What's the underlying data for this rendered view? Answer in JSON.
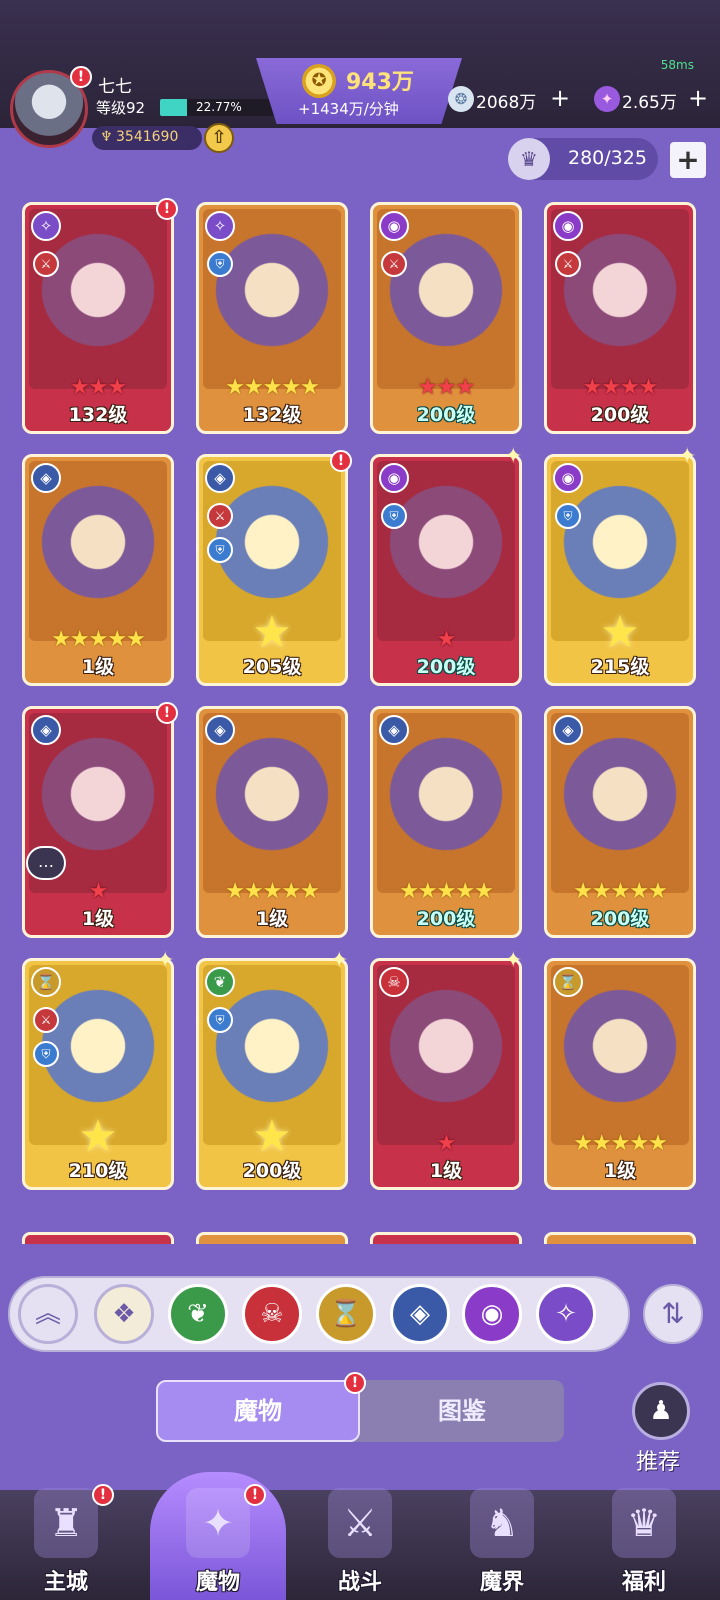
{
  "status": {
    "ping": "58ms"
  },
  "player": {
    "name": "七七",
    "level_label": "等级92",
    "xp_percent_text": "22.77%",
    "xp_fraction": 0.2277,
    "power": "3541690"
  },
  "currencies": {
    "gold_amount": "943万",
    "gold_rate": "+1434万/分钟",
    "gems_amount": "2068万",
    "crystals_amount": "2.65万"
  },
  "roster": {
    "capacity": "280/325"
  },
  "icons": {
    "alert": "!",
    "add": "+",
    "power": "♆",
    "up_arrow": "⇧",
    "gold": "✪",
    "gem": "❂",
    "crystal": "✦",
    "slot": "♛",
    "sort": "⇅",
    "recommend": "♟",
    "chat": "…",
    "sparkle": "✦"
  },
  "cards": [
    {
      "level": "132级",
      "frame": "red",
      "faction": "✧",
      "faction_color": "#7a4cc8",
      "stars": "★★★",
      "star_style": "red",
      "role": "atk",
      "level_style": "white",
      "alert": true
    },
    {
      "level": "132级",
      "frame": "orange",
      "faction": "✧",
      "faction_color": "#7a4cc8",
      "stars": "★★★★★",
      "star_style": "gold",
      "role": "def",
      "level_style": "white"
    },
    {
      "level": "200级",
      "frame": "orange",
      "faction": "◉",
      "faction_color": "#8a3cc8",
      "stars": "★★★",
      "star_style": "red",
      "role": "atk",
      "level_style": "teal"
    },
    {
      "level": "200级",
      "frame": "red",
      "faction": "◉",
      "faction_color": "#8a3cc8",
      "stars": "★★★★",
      "star_style": "red",
      "role": "atk",
      "level_style": "white"
    },
    {
      "level": "1级",
      "frame": "orange",
      "faction": "◈",
      "faction_color": "#3a5aa8",
      "stars": "★★★★★",
      "star_style": "gold",
      "role": "",
      "level_style": "white"
    },
    {
      "level": "205级",
      "frame": "gold",
      "faction": "◈",
      "faction_color": "#3a5aa8",
      "stars": "★",
      "star_style": "big",
      "role": "atk",
      "role2": "def",
      "level_style": "white",
      "alert": true
    },
    {
      "level": "200级",
      "frame": "red",
      "faction": "◉",
      "faction_color": "#8a3cc8",
      "stars": "★",
      "star_style": "red",
      "role": "def",
      "level_style": "teal",
      "sparkle": true
    },
    {
      "level": "215级",
      "frame": "gold",
      "faction": "◉",
      "faction_color": "#8a3cc8",
      "stars": "★",
      "star_style": "big",
      "role": "def",
      "level_style": "white",
      "sparkle": true
    },
    {
      "level": "1级",
      "frame": "red",
      "faction": "◈",
      "faction_color": "#3a5aa8",
      "stars": "★",
      "star_style": "red",
      "role": "",
      "level_style": "white",
      "alert": true
    },
    {
      "level": "1级",
      "frame": "orange",
      "faction": "◈",
      "faction_color": "#3a5aa8",
      "stars": "★★★★★",
      "star_style": "gold",
      "role": "",
      "level_style": "white"
    },
    {
      "level": "200级",
      "frame": "orange",
      "faction": "◈",
      "faction_color": "#3a5aa8",
      "stars": "★★★★★",
      "star_style": "gold",
      "role": "",
      "level_style": "teal"
    },
    {
      "level": "200级",
      "frame": "orange",
      "faction": "◈",
      "faction_color": "#3a5aa8",
      "stars": "★★★★★",
      "star_style": "gold",
      "role": "",
      "level_style": "teal"
    },
    {
      "level": "210级",
      "frame": "gold",
      "faction": "⌛",
      "faction_color": "#c89a2c",
      "stars": "★",
      "star_style": "big",
      "role": "atk",
      "role2": "def",
      "level_style": "white",
      "sparkle": true
    },
    {
      "level": "200级",
      "frame": "gold",
      "faction": "❦",
      "faction_color": "#3a9a4a",
      "stars": "★",
      "star_style": "big",
      "role": "def",
      "level_style": "white",
      "sparkle": true
    },
    {
      "level": "1级",
      "frame": "red",
      "faction": "☠",
      "faction_color": "#c8303a",
      "stars": "★",
      "star_style": "red",
      "role": "",
      "level_style": "white",
      "sparkle": true
    },
    {
      "level": "1级",
      "frame": "orange",
      "faction": "⌛",
      "faction_color": "#c89a2c",
      "stars": "★★★★★",
      "star_style": "gold",
      "role": "",
      "level_style": "white"
    }
  ],
  "filters": [
    {
      "name": "collapse",
      "glyph": "︽",
      "bg": "#e6e1f2",
      "fg": "#6b5aa8"
    },
    {
      "name": "all",
      "glyph": "❖",
      "bg": "#f3ecd8",
      "fg": "#6b5aa8"
    },
    {
      "name": "nature",
      "glyph": "❦",
      "bg": "#3a9a4a",
      "fg": "#ffffff"
    },
    {
      "name": "demon",
      "glyph": "☠",
      "bg": "#c8303a",
      "fg": "#ffffff"
    },
    {
      "name": "time",
      "glyph": "⌛",
      "bg": "#c89a2c",
      "fg": "#ffffff"
    },
    {
      "name": "beast",
      "glyph": "◈",
      "bg": "#3a5aa8",
      "fg": "#ffffff"
    },
    {
      "name": "eye",
      "glyph": "◉",
      "bg": "#8a3cc8",
      "fg": "#ffffff"
    },
    {
      "name": "arcane",
      "glyph": "✧",
      "bg": "#7a4cc8",
      "fg": "#ffffff"
    }
  ],
  "tabs": {
    "monsters": "魔物",
    "codex": "图鉴"
  },
  "recommend_label": "推荐",
  "nav": [
    {
      "id": "main-city",
      "label": "主城",
      "glyph": "♜",
      "alert": true
    },
    {
      "id": "monsters",
      "label": "魔物",
      "glyph": "✦",
      "alert": true,
      "active": true
    },
    {
      "id": "battle",
      "label": "战斗",
      "glyph": "⚔"
    },
    {
      "id": "demon-realm",
      "label": "魔界",
      "glyph": "♞"
    },
    {
      "id": "welfare",
      "label": "福利",
      "glyph": "♛"
    }
  ]
}
